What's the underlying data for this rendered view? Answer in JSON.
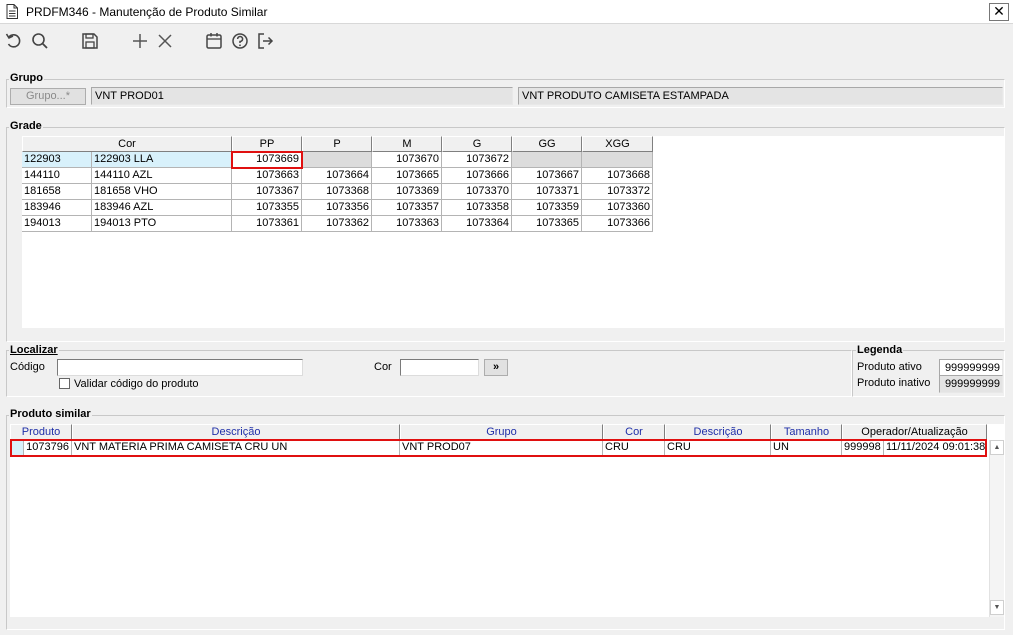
{
  "window": {
    "title": "PRDFM346 - Manutenção de Produto Similar",
    "close_label": "✕"
  },
  "toolbar": {
    "icons": [
      "undo-icon",
      "search-icon",
      "save-icon",
      "add-icon",
      "cancel-icon",
      "calendar-icon",
      "help-icon",
      "exit-icon"
    ]
  },
  "grupo": {
    "label": "Grupo",
    "button_label": "Grupo...*",
    "code": "VNT PROD01",
    "description": "VNT PRODUTO CAMISETA ESTAMPADA"
  },
  "grade": {
    "label": "Grade",
    "headers": [
      "Cor",
      "PP",
      "P",
      "M",
      "G",
      "GG",
      "XGG"
    ],
    "rows": [
      {
        "code": "122903",
        "cor": "122903 LLA",
        "pp": "1073669",
        "p": "",
        "m": "1073670",
        "g": "1073672",
        "gg": "",
        "xgg": ""
      },
      {
        "code": "144110",
        "cor": "144110 AZL",
        "pp": "1073663",
        "p": "1073664",
        "m": "1073665",
        "g": "1073666",
        "gg": "1073667",
        "xgg": "1073668"
      },
      {
        "code": "181658",
        "cor": "181658 VHO",
        "pp": "1073367",
        "p": "1073368",
        "m": "1073369",
        "g": "1073370",
        "gg": "1073371",
        "xgg": "1073372"
      },
      {
        "code": "183946",
        "cor": "183946 AZL",
        "pp": "1073355",
        "p": "1073356",
        "m": "1073357",
        "g": "1073358",
        "gg": "1073359",
        "xgg": "1073360"
      },
      {
        "code": "194013",
        "cor": "194013 PTO",
        "pp": "1073361",
        "p": "1073362",
        "m": "1073363",
        "g": "1073364",
        "gg": "1073365",
        "xgg": "1073366"
      }
    ]
  },
  "localizar": {
    "label": "Localizar",
    "codigo_label": "Código",
    "codigo_value": "",
    "cor_label": "Cor",
    "cor_value": "",
    "go_label": "»",
    "validar_label": "Validar código do produto"
  },
  "legenda": {
    "label": "Legenda",
    "ativo_label": "Produto ativo",
    "ativo_value": "999999999",
    "inativo_label": "Produto inativo",
    "inativo_value": "999999999"
  },
  "similar": {
    "label": "Produto similar",
    "headers": [
      "Produto",
      "Descrição",
      "Grupo",
      "Cor",
      "Descrição",
      "Tamanho",
      "Operador/Atualização"
    ],
    "row": {
      "produto": "1073796",
      "descricao": "VNT MATERIA PRIMA CAMISETA CRU UN",
      "grupo": "VNT PROD07",
      "cor": "CRU",
      "cor_descricao": "CRU",
      "tamanho": "UN",
      "operador": "999998",
      "atualizacao": "11/11/2024 09:01:38"
    }
  },
  "colors": {
    "selected_row": "#d8f1fb",
    "highlight_border": "#e01010",
    "header_blue": "#1f2fa8"
  }
}
